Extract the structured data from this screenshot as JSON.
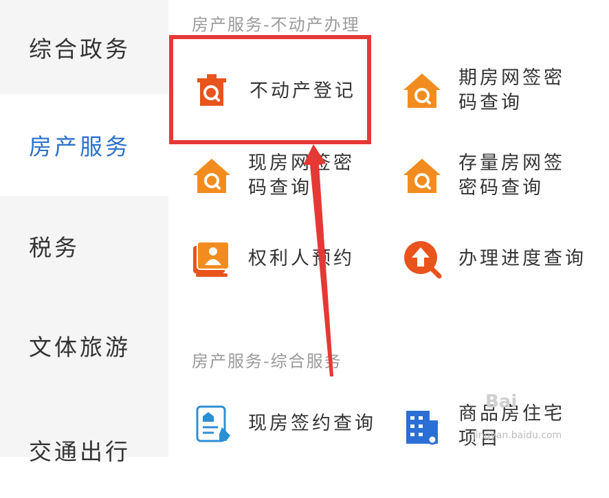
{
  "sidebar": {
    "items": [
      {
        "label": "综合政务"
      },
      {
        "label": "房产服务"
      },
      {
        "label": "税务"
      },
      {
        "label": "文体旅游"
      },
      {
        "label": "交通出行"
      }
    ]
  },
  "section1": {
    "title": "房产服务-不动产办理",
    "tiles": [
      {
        "label": "不动产登记",
        "icon": "house-search-icon"
      },
      {
        "label": "期房网签密码查询",
        "icon": "house-search-icon"
      },
      {
        "label": "现房网签密码查询",
        "icon": "house-search-icon"
      },
      {
        "label": "存量房网签密码查询",
        "icon": "house-search-icon"
      },
      {
        "label": "权利人预约",
        "icon": "id-card-icon"
      },
      {
        "label": "办理进度查询",
        "icon": "upload-search-icon"
      }
    ]
  },
  "section2": {
    "title": "房产服务-综合服务",
    "tiles": [
      {
        "label": "现房签约查询",
        "icon": "document-edit-icon"
      },
      {
        "label": "商品房住宅项目",
        "icon": "building-search-icon"
      }
    ]
  },
  "watermark": {
    "text": "jingyan.baidu.com",
    "logo": "Bai"
  },
  "colors": {
    "accent": "#2b72c9",
    "icon_orange": "#f28c1e",
    "icon_red_orange": "#e8541c",
    "highlight": "#e53935"
  }
}
